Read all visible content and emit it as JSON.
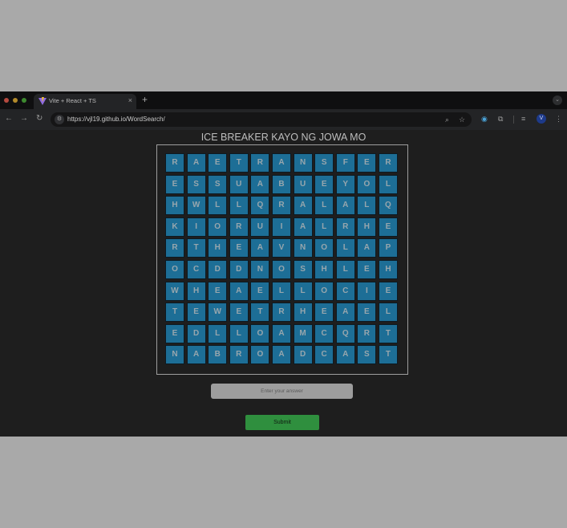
{
  "browser": {
    "tab_title": "Vite + React + TS",
    "tab_close": "×",
    "new_tab": "+",
    "url": "https://vjl19.github.io/WordSearch/",
    "profile_initial": "V"
  },
  "page": {
    "title": "ICE BREAKER KAYO NG JOWA MO",
    "grid": [
      [
        "R",
        "A",
        "E",
        "T",
        "R",
        "A",
        "N",
        "S",
        "F",
        "E",
        "R"
      ],
      [
        "E",
        "S",
        "S",
        "U",
        "A",
        "B",
        "U",
        "E",
        "Y",
        "O",
        "L"
      ],
      [
        "H",
        "W",
        "L",
        "L",
        "Q",
        "R",
        "A",
        "L",
        "A",
        "L",
        "Q"
      ],
      [
        "K",
        "I",
        "O",
        "R",
        "U",
        "I",
        "A",
        "L",
        "R",
        "H",
        "E"
      ],
      [
        "R",
        "T",
        "H",
        "E",
        "A",
        "V",
        "N",
        "O",
        "L",
        "A",
        "P"
      ],
      [
        "O",
        "C",
        "D",
        "D",
        "N",
        "O",
        "S",
        "H",
        "L",
        "E",
        "H"
      ],
      [
        "W",
        "H",
        "E",
        "A",
        "E",
        "L",
        "L",
        "O",
        "C",
        "I",
        "E"
      ],
      [
        "T",
        "E",
        "W",
        "E",
        "T",
        "R",
        "H",
        "E",
        "A",
        "E",
        "L"
      ],
      [
        "E",
        "D",
        "L",
        "L",
        "O",
        "A",
        "M",
        "C",
        "Q",
        "R",
        "T"
      ],
      [
        "N",
        "A",
        "B",
        "R",
        "O",
        "A",
        "D",
        "C",
        "A",
        "S",
        "T"
      ]
    ],
    "answer_placeholder": "Enter your answer",
    "answer_value": "",
    "submit_label": "Submit"
  },
  "colors": {
    "cell_background": "#1d6e96",
    "submit_background": "#2f8f3e",
    "page_background": "#1e1e1e"
  },
  "icons": [
    "back-arrow-icon",
    "forward-arrow-icon",
    "reload-icon",
    "site-settings-icon",
    "zoom-icon",
    "bookmark-star-icon",
    "extension-icon",
    "puzzle-icon",
    "reading-list-icon",
    "more-menu-icon",
    "tab-search-icon"
  ]
}
